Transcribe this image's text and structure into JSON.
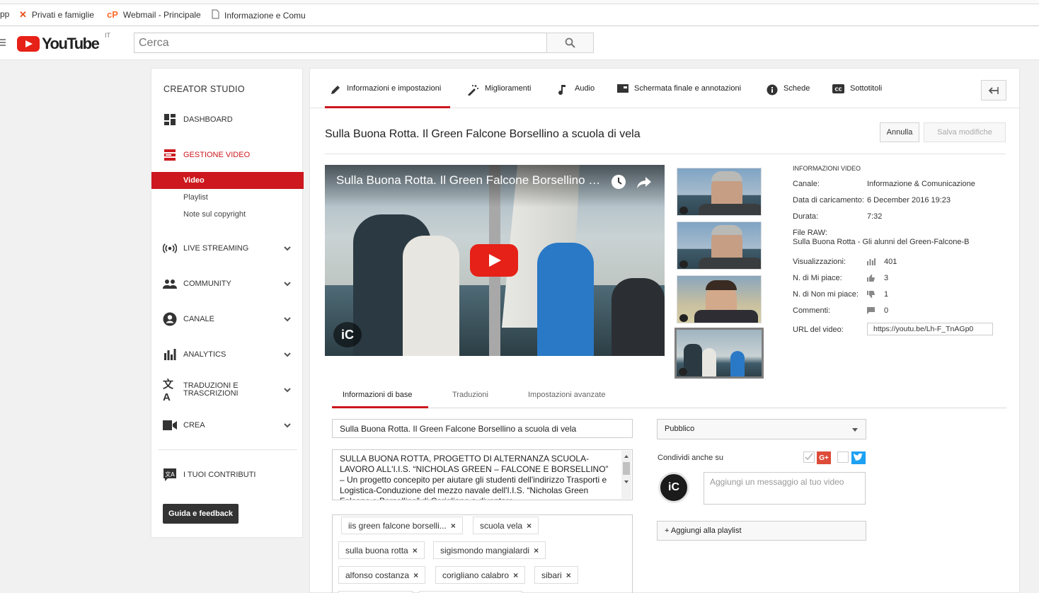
{
  "bookmarks": [
    {
      "label": "pp",
      "icon": "apps-icon"
    },
    {
      "label": "Privati e famiglie",
      "icon": "bank-icon"
    },
    {
      "label": "Webmail - Principale",
      "icon": "cpanel-icon"
    },
    {
      "label": "Informazione e Comu",
      "icon": "page-icon"
    }
  ],
  "header": {
    "logo_text": "YouTube",
    "country": "IT",
    "search_placeholder": "Cerca"
  },
  "sidebar": {
    "title": "CREATOR STUDIO",
    "items": [
      {
        "label": "DASHBOARD",
        "icon": "dashboard-icon"
      },
      {
        "label": "GESTIONE VIDEO",
        "icon": "video-manager-icon"
      },
      {
        "label": "LIVE STREAMING",
        "icon": "live-icon"
      },
      {
        "label": "COMMUNITY",
        "icon": "people-icon"
      },
      {
        "label": "CANALE",
        "icon": "account-icon"
      },
      {
        "label": "ANALYTICS",
        "icon": "bar-chart-icon"
      },
      {
        "label": "TRADUZIONI E TRASCRIZIONI",
        "icon": "translate-icon"
      },
      {
        "label": "CREA",
        "icon": "camera-icon"
      },
      {
        "label": "I TUOI CONTRIBUTI",
        "icon": "contributions-icon"
      }
    ],
    "sub": [
      "Video",
      "Playlist",
      "Note sul copyright"
    ],
    "help_button": "Guida e feedback"
  },
  "tabs": [
    {
      "label": "Informazioni e impostazioni",
      "icon": "pencil-icon"
    },
    {
      "label": "Miglioramenti",
      "icon": "magic-wand-icon"
    },
    {
      "label": "Audio",
      "icon": "music-note-icon"
    },
    {
      "label": "Schermata finale e annotazioni",
      "icon": "end-screen-icon"
    },
    {
      "label": "Schede",
      "icon": "info-icon"
    },
    {
      "label": "Sottotitoli",
      "icon": "cc-icon"
    }
  ],
  "video": {
    "title": "Sulla Buona Rotta. Il Green Falcone Borsellino a scuola di vela",
    "player_title": "Sulla Buona Rotta. Il Green Falcone Borsellino a scuola di vela",
    "watermark": "iC"
  },
  "actions": {
    "cancel": "Annulla",
    "save": "Salva modifiche"
  },
  "info": {
    "heading": "INFORMAZIONI VIDEO",
    "channel_label": "Canale:",
    "channel": "Informazione & Comunicazione",
    "upload_label": "Data di caricamento:",
    "upload_date": "6 December 2016 19:23",
    "duration_label": "Durata:",
    "duration": "7:32",
    "raw_label": "File RAW:",
    "raw_file": "Sulla Buona Rotta - Gli alunni del Green-Falcone-B",
    "views_label": "Visualizzazioni:",
    "views": "401",
    "likes_label": "N. di Mi piace:",
    "likes": "3",
    "dislikes_label": "N. di Non mi piace:",
    "dislikes": "1",
    "comments_label": "Commenti:",
    "comments": "0",
    "url_label": "URL del video:",
    "url": "https://youtu.be/Lh-F_TnAGp0"
  },
  "lower_tabs": [
    "Informazioni di base",
    "Traduzioni",
    "Impostazioni avanzate"
  ],
  "form": {
    "title_value": "Sulla Buona Rotta. Il Green Falcone Borsellino a scuola di vela",
    "description": "SULLA BUONA ROTTA, PROGETTO DI ALTERNANZA SCUOLA-LAVORO ALL'I.I.S. “NICHOLAS GREEN – FALCONE E BORSELLINO” – Un progetto concepito per aiutare gli studenti dell'indirizzo Trasporti e Logistica-Conduzione del mezzo navale dell'I.I.S. “Nicholas Green Falcone e Borsellino” di Corigliano a diventare",
    "tags": [
      "iis green falcone borselli...",
      "scuola vela",
      "sulla buona rotta",
      "sigismondo mangialardi",
      "alfonso costanza",
      "corigliano calabro",
      "sibari"
    ],
    "privacy": "Pubblico",
    "share_label": "Condividi anche su",
    "gplus": "G+",
    "message_placeholder": "Aggiungi un messaggio al tuo video",
    "add_playlist": "+ Aggiungi alla playlist"
  },
  "colors": {
    "accent": "#cc181e",
    "youtube_red": "#e62117"
  }
}
